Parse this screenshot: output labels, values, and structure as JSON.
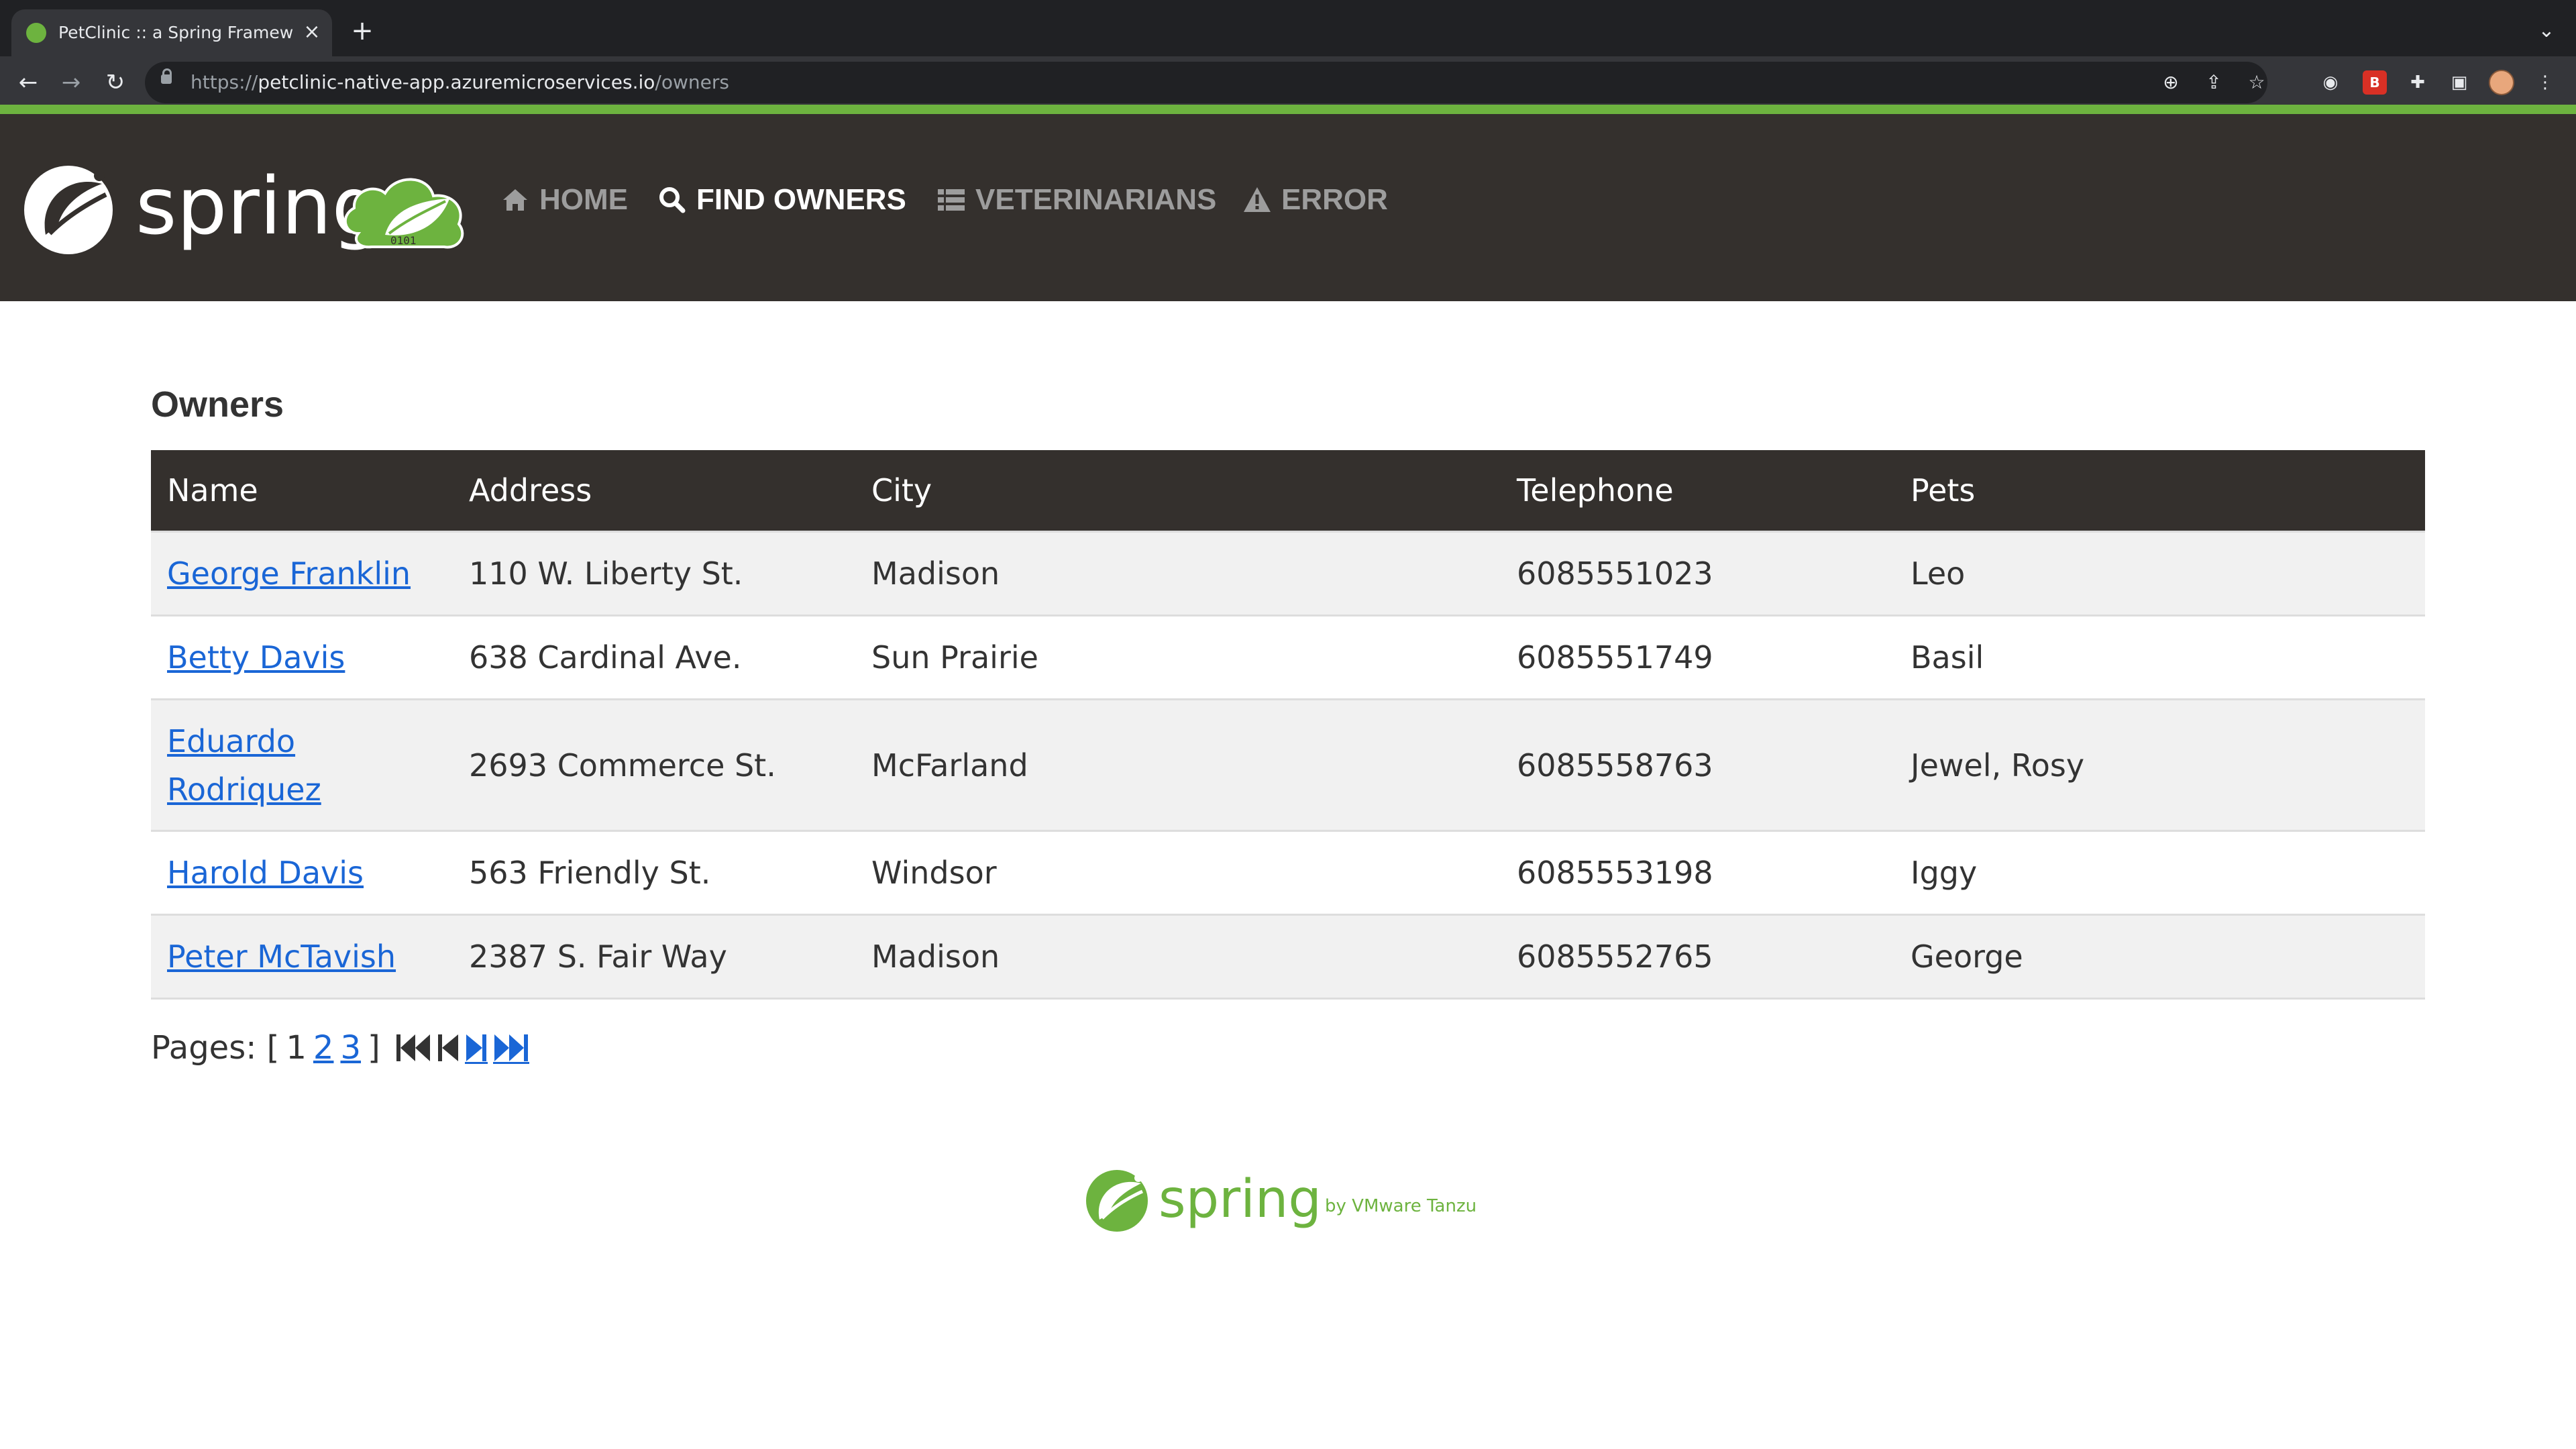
{
  "browser": {
    "tab_title": "PetClinic :: a Spring Framework",
    "tab_close": "×",
    "new_tab": "+",
    "tab_menu": "⌄",
    "url_scheme": "https://",
    "url_host": "petclinic-native-app.azuremicroservices.io",
    "url_path": "/owners",
    "ext_badge": "B"
  },
  "nav": {
    "logo_text": "spring",
    "items": [
      {
        "label": "HOME",
        "icon": "home-icon"
      },
      {
        "label": "FIND OWNERS",
        "icon": "search-icon",
        "active": true
      },
      {
        "label": "VETERINARIANS",
        "icon": "list-icon"
      },
      {
        "label": "ERROR",
        "icon": "warning-icon"
      }
    ]
  },
  "owners": {
    "heading": "Owners",
    "columns": [
      "Name",
      "Address",
      "City",
      "Telephone",
      "Pets"
    ],
    "rows": [
      {
        "name": "George Franklin",
        "address": "110 W. Liberty St.",
        "city": "Madison",
        "telephone": "6085551023",
        "pets": "Leo"
      },
      {
        "name": "Betty Davis",
        "address": "638 Cardinal Ave.",
        "city": "Sun Prairie",
        "telephone": "6085551749",
        "pets": "Basil"
      },
      {
        "name": "Eduardo Rodriquez",
        "address": "2693 Commerce St.",
        "city": "McFarland",
        "telephone": "6085558763",
        "pets": "Jewel, Rosy"
      },
      {
        "name": "Harold Davis",
        "address": "563 Friendly St.",
        "city": "Windsor",
        "telephone": "6085553198",
        "pets": "Iggy"
      },
      {
        "name": "Peter McTavish",
        "address": "2387 S. Fair Way",
        "city": "Madison",
        "telephone": "6085552765",
        "pets": "George"
      }
    ]
  },
  "pagination": {
    "label": "Pages: [",
    "current": "1",
    "pages": [
      "2",
      "3"
    ],
    "close": "]"
  },
  "footer": {
    "logo_text": "spring",
    "tagline": "by VMware Tanzu"
  },
  "colors": {
    "brand_green": "#6db33f",
    "nav_bg": "#34302d",
    "link_blue": "#1a66d6"
  }
}
